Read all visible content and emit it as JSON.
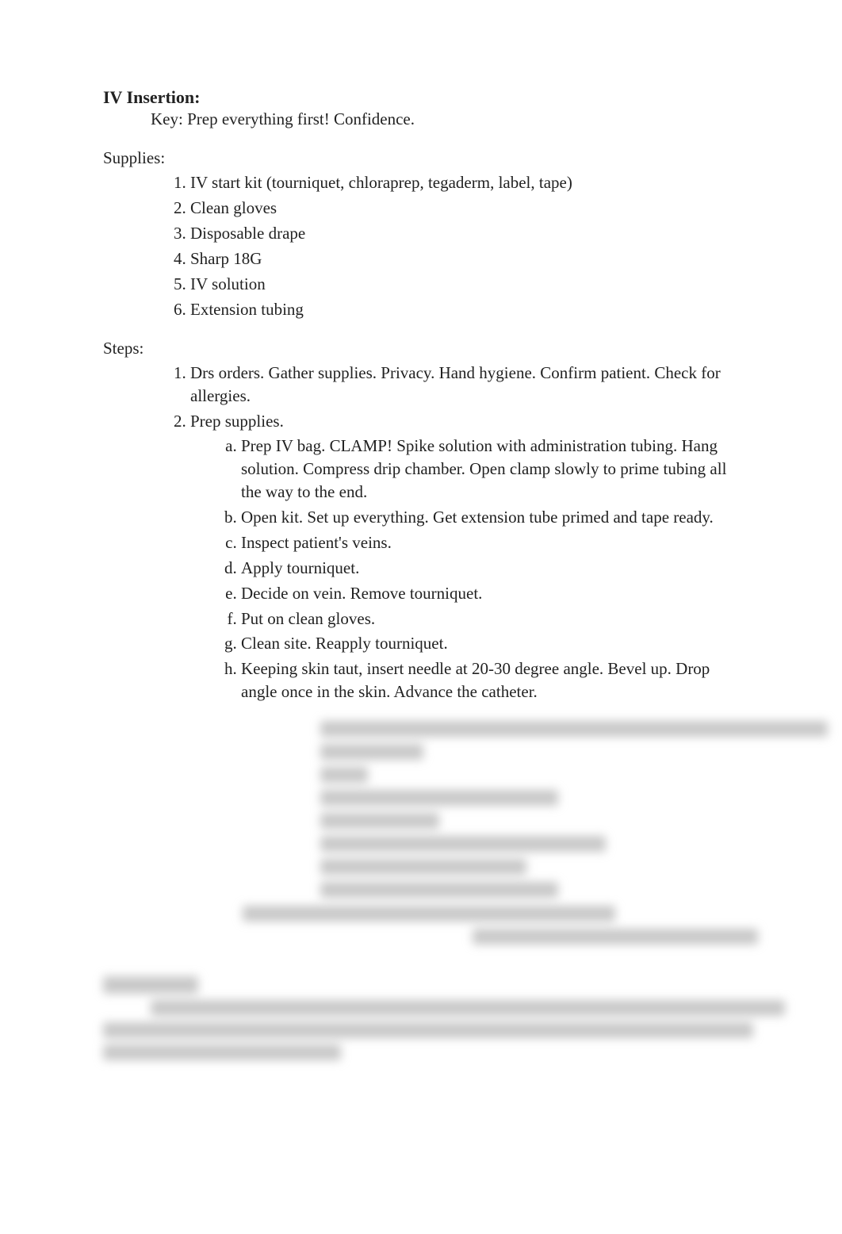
{
  "title": "IV Insertion:",
  "key_line": "Key: Prep everything first! Confidence.",
  "supplies_label": "Supplies:",
  "supplies": [
    "IV start kit (tourniquet, chloraprep, tegaderm, label, tape)",
    "Clean gloves",
    "Disposable drape",
    "Sharp 18G",
    "IV solution",
    "Extension tubing"
  ],
  "steps_label": "Steps:",
  "step1": "Drs orders. Gather supplies. Privacy. Hand hygiene. Confirm patient. Check for allergies.",
  "step2_label": "Prep supplies.",
  "step2_subs": [
    "Prep IV bag. CLAMP! Spike solution with administration tubing. Hang solution. Compress drip chamber. Open clamp slowly to prime tubing all the way to the end.",
    "Open kit. Set up everything. Get extension tube primed and tape ready.",
    "Inspect patient's veins.",
    "Apply tourniquet.",
    "Decide on vein. Remove tourniquet.",
    "Put on clean gloves.",
    "Clean site. Reapply tourniquet.",
    "Keeping skin taut, insert needle at 20-30 degree angle. Bevel up. Drop angle once in the skin. Advance the catheter."
  ]
}
